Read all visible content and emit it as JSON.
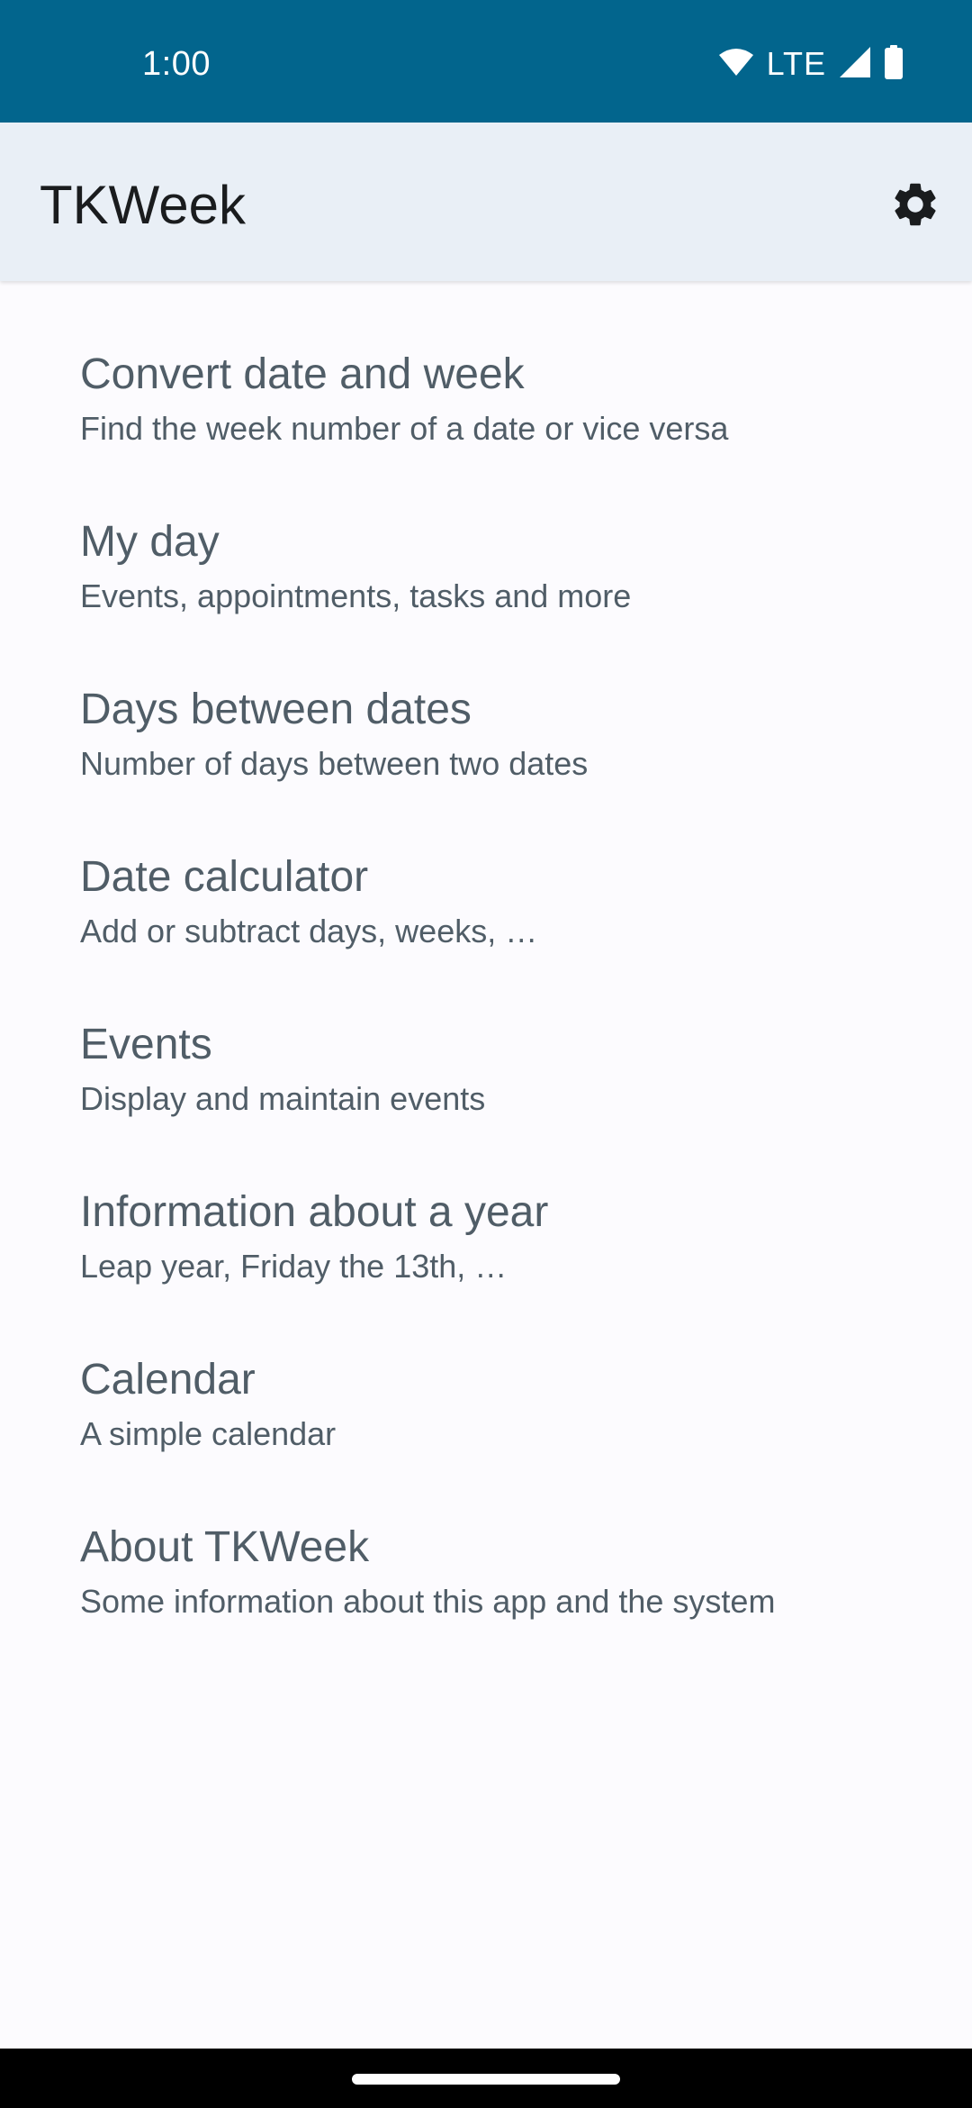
{
  "status_bar": {
    "time": "1:00",
    "network": "LTE",
    "icons": [
      "wifi-icon",
      "cell-signal-icon",
      "battery-icon"
    ],
    "background_color": "#02658d"
  },
  "app_bar": {
    "title": "TKWeek",
    "settings_icon": "gear-icon",
    "background_color": "#e9eff6"
  },
  "menu": {
    "items": [
      {
        "title": "Convert date and week",
        "subtitle": "Find the week number of a date or vice versa"
      },
      {
        "title": "My day",
        "subtitle": "Events, appointments, tasks and more"
      },
      {
        "title": "Days between dates",
        "subtitle": "Number of days between two dates"
      },
      {
        "title": "Date calculator",
        "subtitle": "Add or subtract days, weeks, …"
      },
      {
        "title": "Events",
        "subtitle": "Display and maintain events"
      },
      {
        "title": "Information about a year",
        "subtitle": "Leap year, Friday the 13th, …"
      },
      {
        "title": "Calendar",
        "subtitle": "A simple calendar"
      },
      {
        "title": "About TKWeek",
        "subtitle": "Some information about this app and the system"
      }
    ],
    "text_color": "#505d67"
  }
}
